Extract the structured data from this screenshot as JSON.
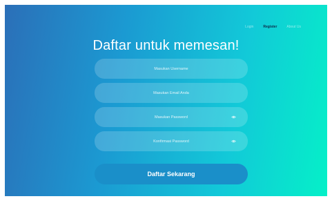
{
  "nav": {
    "login": "Login",
    "register": "Register",
    "about": "About Us"
  },
  "title": "Daftar untuk memesan!",
  "fields": {
    "username": "Masukan Username",
    "email": "Masukan Email Anda",
    "password": "Masukan Password",
    "confirm": "Konfirmasi Password"
  },
  "icons": {
    "password_toggle": "eye-icon"
  },
  "submit_label": "Daftar Sekarang",
  "colors": {
    "gradient_start": "#2b6fb8",
    "gradient_end": "#05f0c8",
    "button": "#1a8fc9",
    "active_nav": "#0d2b4a"
  }
}
